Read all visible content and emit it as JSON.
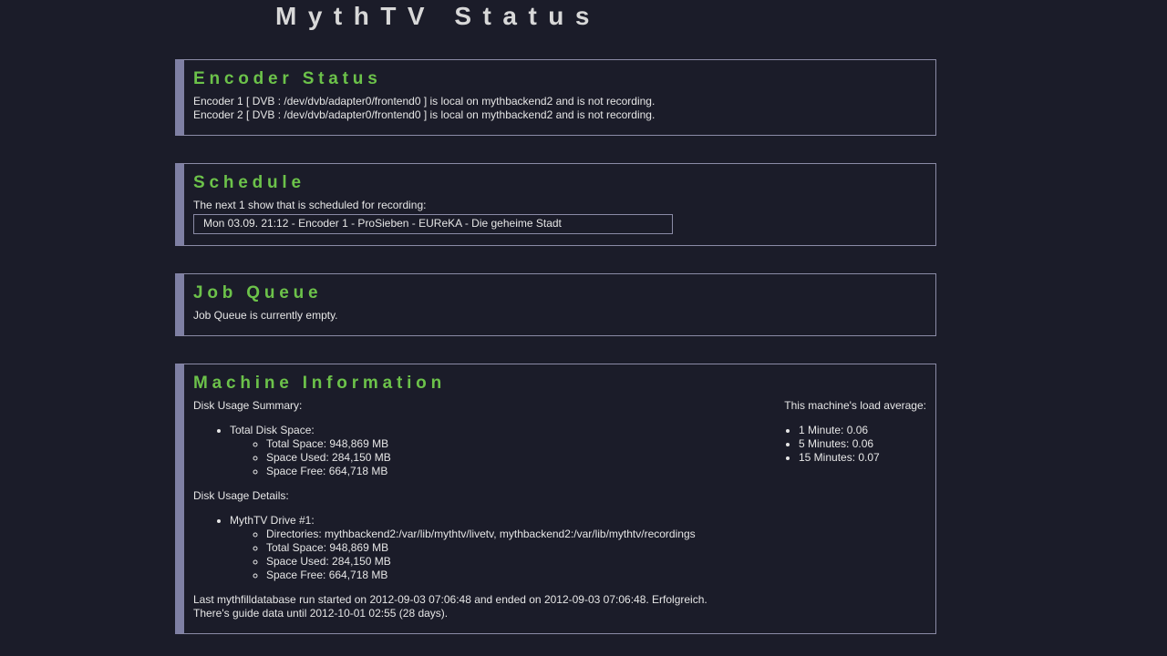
{
  "page_title": "MythTV Status",
  "encoder": {
    "heading": "Encoder Status",
    "lines": [
      "Encoder 1 [ DVB : /dev/dvb/adapter0/frontend0 ] is local on mythbackend2 and is not recording.",
      "Encoder 2 [ DVB : /dev/dvb/adapter0/frontend0 ] is local on mythbackend2 and is not recording."
    ]
  },
  "schedule": {
    "heading": "Schedule",
    "intro": "The next 1 show that is scheduled for recording:",
    "entry": "Mon 03.09. 21:12 - Encoder 1 - ProSieben - EUReKA - Die geheime Stadt"
  },
  "job_queue": {
    "heading": "Job Queue",
    "text": "Job Queue is currently empty."
  },
  "machine": {
    "heading": "Machine Information",
    "disk_summary": {
      "label": "Disk Usage Summary:",
      "item": "Total Disk Space:",
      "sub_items": [
        "Total Space: 948,869 MB",
        "Space Used: 284,150 MB",
        "Space Free: 664,718 MB"
      ]
    },
    "disk_details": {
      "label": "Disk Usage Details:",
      "item": "MythTV Drive #1:",
      "sub_items": [
        "Directories: mythbackend2:/var/lib/mythtv/livetv, mythbackend2:/var/lib/mythtv/recordings",
        "Total Space: 948,869 MB",
        "Space Used: 284,150 MB",
        "Space Free: 664,718 MB"
      ]
    },
    "load": {
      "label": "This machine's load average:",
      "items": [
        "1 Minute: 0.06",
        "5 Minutes: 0.06",
        "15 Minutes: 0.07"
      ]
    },
    "footer_lines": [
      "Last mythfilldatabase run started on 2012-09-03 07:06:48 and ended on 2012-09-03 07:06:48. Erfolgreich.",
      "There's guide data until 2012-10-01 02:55 (28 days)."
    ]
  },
  "colors": {
    "background": "#1b1c29",
    "heading_green": "#6cc24a",
    "border_accent": "#7f80a4",
    "text": "#e6e6e6"
  }
}
